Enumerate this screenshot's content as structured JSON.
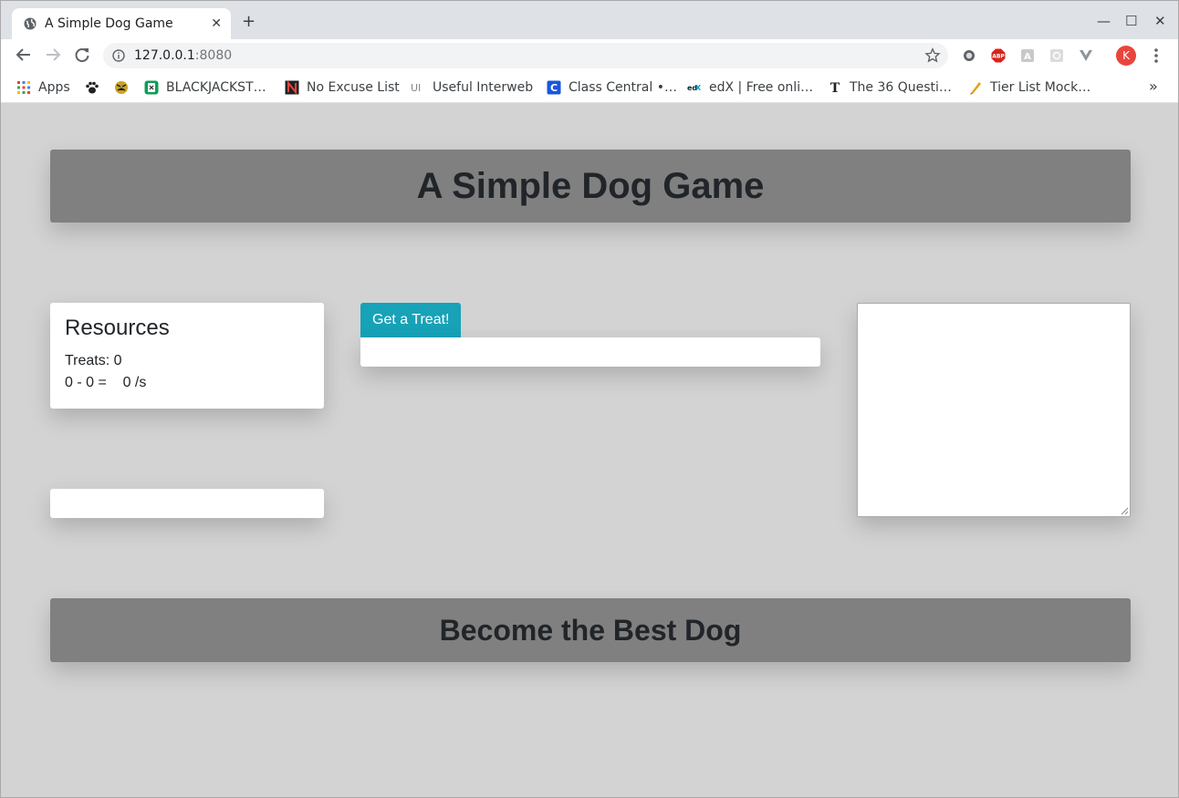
{
  "browser": {
    "tab_title": "A Simple Dog Game",
    "tab_close": "✕",
    "new_tab": "+",
    "window_controls": {
      "minimize": "—",
      "maximize": "☐",
      "close": "✕"
    },
    "url_host": "127.0.0.1",
    "url_port": ":8080",
    "profile_initial": "K",
    "bookmarks": [
      {
        "label": "Apps",
        "icon": "apps-grid-icon"
      },
      {
        "label": "",
        "icon": "paw-icon"
      },
      {
        "label": "",
        "icon": "tiger-icon"
      },
      {
        "label": "BLACKJACKST…",
        "icon": "blackjack-icon"
      },
      {
        "label": "No Excuse List",
        "icon": "no-excuse-list-icon"
      },
      {
        "label": "Useful Interweb",
        "icon": "ui-text-icon"
      },
      {
        "label": "Class Central •…",
        "icon": "class-central-icon"
      },
      {
        "label": "edX | Free onli…",
        "icon": "edx-icon"
      },
      {
        "label": "The 36 Questi…",
        "icon": "nyt-icon"
      },
      {
        "label": "Tier List Mock…",
        "icon": "tier-list-icon"
      }
    ],
    "bookmarks_more": "»"
  },
  "page": {
    "title": "A Simple Dog Game",
    "resources": {
      "heading": "Resources",
      "treats_line": "Treats: 0",
      "rate_line": "0 - 0 =    0 /s"
    },
    "treat_button": "Get a Treat!",
    "footer": "Become the Best Dog"
  },
  "colors": {
    "page_background": "#d3d3d3",
    "banner": "#808080",
    "button": "#17a2b8",
    "text": "#212529"
  }
}
